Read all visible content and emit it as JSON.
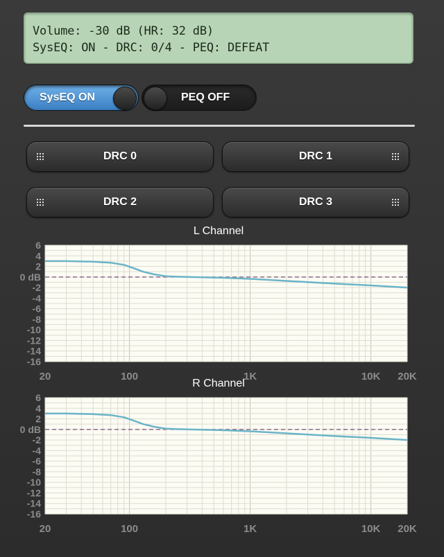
{
  "status": {
    "line1": "Volume: -30 dB (HR: 32 dB)",
    "line2": "SysEQ: ON - DRC: 0/4 - PEQ: DEFEAT"
  },
  "toggles": {
    "syseq": {
      "label": "SysEQ ON",
      "state": "on"
    },
    "peq": {
      "label": "PEQ OFF",
      "state": "off"
    }
  },
  "drc_buttons": [
    "DRC 0",
    "DRC 1",
    "DRC 2",
    "DRC 3"
  ],
  "colors": {
    "accent": "#4a90d9",
    "curve": "#6ab4c8",
    "lcd_bg": "#b8d4b6",
    "plot_bg": "#fdfcf4",
    "zero_line": "#8a6a8a"
  },
  "chart_data": [
    {
      "type": "line",
      "title": "L Channel",
      "x_scale": "log",
      "xlim": [
        20,
        20000
      ],
      "ylim": [
        -16,
        6
      ],
      "x_ticks": [
        {
          "value": 20,
          "label": "20"
        },
        {
          "value": 100,
          "label": "100"
        },
        {
          "value": 1000,
          "label": "1K"
        },
        {
          "value": 10000,
          "label": "10K"
        },
        {
          "value": 20000,
          "label": "20K"
        }
      ],
      "y_ticks": [
        {
          "value": 6,
          "label": "6"
        },
        {
          "value": 4,
          "label": "4"
        },
        {
          "value": 2,
          "label": "2"
        },
        {
          "value": 0,
          "label": "0 dB"
        },
        {
          "value": -2,
          "label": "-2"
        },
        {
          "value": -4,
          "label": "-4"
        },
        {
          "value": -6,
          "label": "-6"
        },
        {
          "value": -8,
          "label": "-8"
        },
        {
          "value": -10,
          "label": "-10"
        },
        {
          "value": -12,
          "label": "-12"
        },
        {
          "value": -14,
          "label": "-14"
        },
        {
          "value": -16,
          "label": "-16"
        }
      ],
      "grid": true,
      "reference_line": 0,
      "series": [
        {
          "x": [
            20,
            30,
            50,
            70,
            90,
            110,
            130,
            160,
            200,
            250,
            300,
            400,
            600,
            1000,
            2000,
            5000,
            10000,
            20000
          ],
          "y": [
            3,
            3,
            2.9,
            2.7,
            2.3,
            1.6,
            1.0,
            0.5,
            0.15,
            0.05,
            0,
            -0.05,
            -0.15,
            -0.35,
            -0.75,
            -1.25,
            -1.6,
            -2.0
          ]
        }
      ]
    },
    {
      "type": "line",
      "title": "R Channel",
      "x_scale": "log",
      "xlim": [
        20,
        20000
      ],
      "ylim": [
        -16,
        6
      ],
      "x_ticks": [
        {
          "value": 20,
          "label": "20"
        },
        {
          "value": 100,
          "label": "100"
        },
        {
          "value": 1000,
          "label": "1K"
        },
        {
          "value": 10000,
          "label": "10K"
        },
        {
          "value": 20000,
          "label": "20K"
        }
      ],
      "y_ticks": [
        {
          "value": 6,
          "label": "6"
        },
        {
          "value": 4,
          "label": "4"
        },
        {
          "value": 2,
          "label": "2"
        },
        {
          "value": 0,
          "label": "0 dB"
        },
        {
          "value": -2,
          "label": "-2"
        },
        {
          "value": -4,
          "label": "-4"
        },
        {
          "value": -6,
          "label": "-6"
        },
        {
          "value": -8,
          "label": "-8"
        },
        {
          "value": -10,
          "label": "-10"
        },
        {
          "value": -12,
          "label": "-12"
        },
        {
          "value": -14,
          "label": "-14"
        },
        {
          "value": -16,
          "label": "-16"
        }
      ],
      "grid": true,
      "reference_line": 0,
      "series": [
        {
          "x": [
            20,
            30,
            50,
            70,
            90,
            110,
            130,
            160,
            200,
            250,
            300,
            400,
            600,
            1000,
            2000,
            5000,
            10000,
            20000
          ],
          "y": [
            3,
            3,
            2.9,
            2.7,
            2.3,
            1.6,
            1.0,
            0.5,
            0.15,
            0.05,
            0,
            -0.05,
            -0.15,
            -0.35,
            -0.75,
            -1.25,
            -1.6,
            -2.0
          ]
        }
      ]
    }
  ]
}
